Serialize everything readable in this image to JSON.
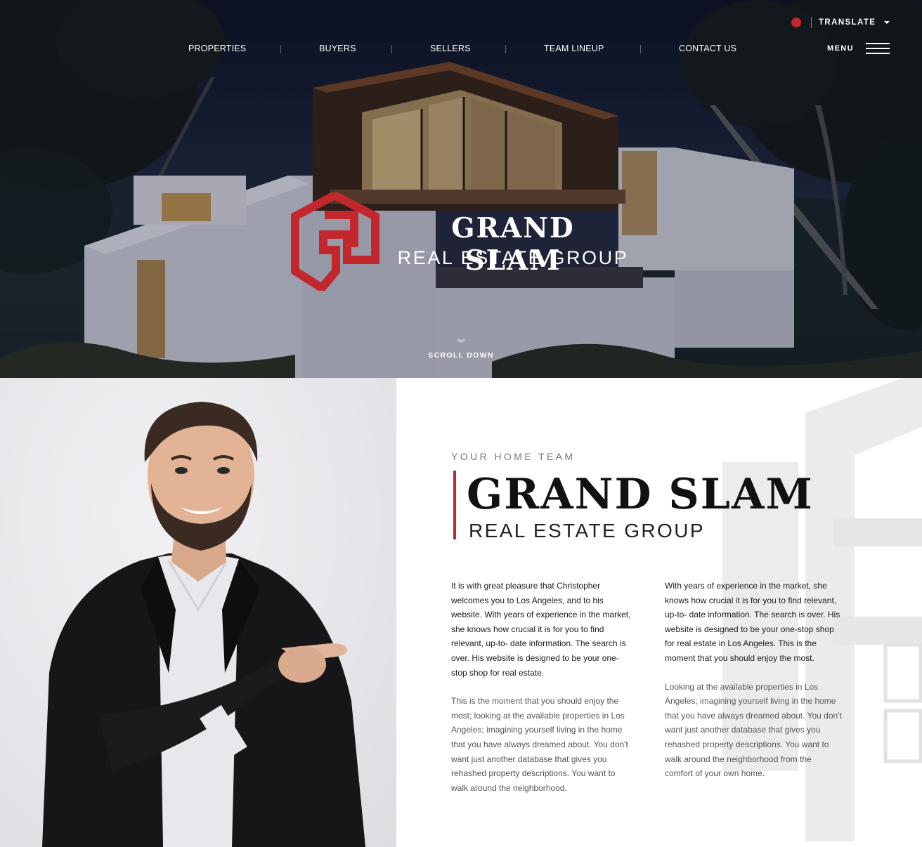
{
  "header": {
    "translate_label": "TRANSLATE",
    "menu_label": "MENU",
    "nav": [
      {
        "label": "PROPERTIES"
      },
      {
        "label": "BUYERS"
      },
      {
        "label": "SELLERS"
      },
      {
        "label": "TEAM LINEUP"
      },
      {
        "label": "CONTACT US"
      }
    ]
  },
  "hero": {
    "brand_line1": "GRAND SLAM",
    "brand_line2": "REAL ESTATE GROUP",
    "scroll_label": "SCROLL DOWN"
  },
  "about": {
    "eyebrow": "YOUR HOME TEAM",
    "title": "GRAND SLAM",
    "subtitle": "REAL ESTATE GROUP",
    "col1_strong": "It is with great pleasure that Christopher welcomes you to Los Angeles, and to his website. With years of experience in the market, she knows how crucial it is for you to find relevant, up-to- date information. The search is over. His website is designed to be your one-stop shop for real estate.",
    "col1_light": "This is the moment that you should enjoy the most; looking at the available properties in Los Angeles; imagining yourself living in the home that you have always dreamed about. You don't want just another database that gives you rehashed property descriptions. You want to walk around the neighborhood.",
    "col2_strong": "With years of experience in the market, she knows how crucial it is for you to find relevant, up-to- date information. The search is over. His website is designed to be your one-stop shop for real estate in Los Angeles. This is the moment that you should enjoy the most.",
    "col2_light": "Looking at the available properties in Los Angeles; imagining yourself living in the home that you have always dreamed about. You don't want just another database that gives you rehashed property descriptions. You want to walk around the neighborhood from the comfort of your own home."
  },
  "colors": {
    "brand_red": "#c1272d",
    "hero_night": "#1a2238",
    "text_dark": "#111111"
  },
  "icons": [
    "globe-icon",
    "caret-down-icon",
    "hamburger-icon",
    "logo-mark-icon",
    "chevron-double-down-icon"
  ]
}
